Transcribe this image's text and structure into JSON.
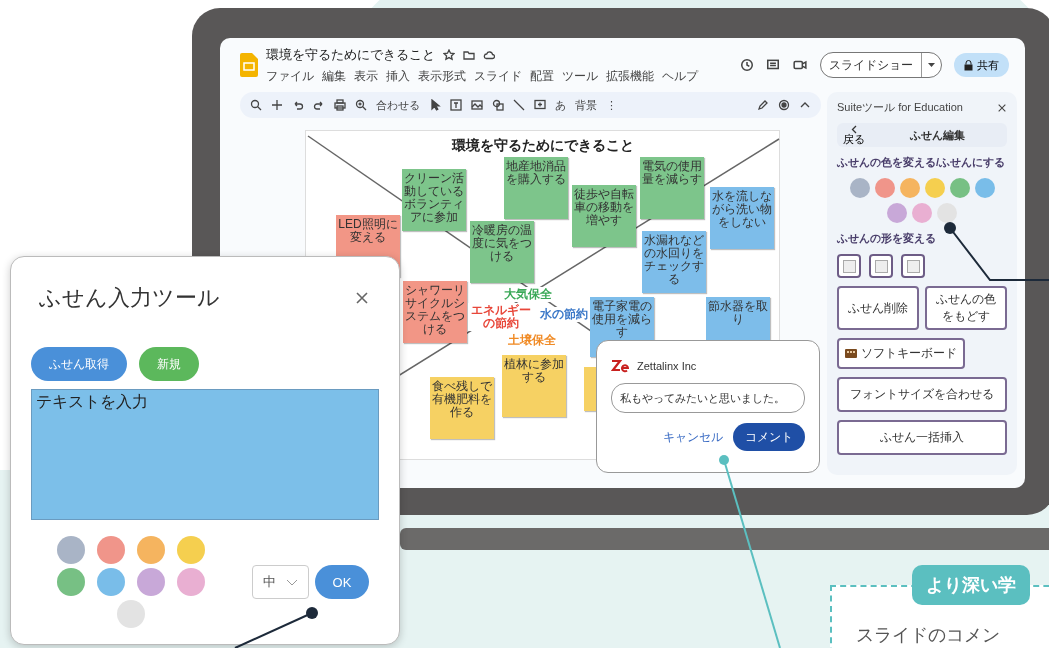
{
  "editor": {
    "title": "環境を守るためにできること",
    "menu": [
      "ファイル",
      "編集",
      "表示",
      "挿入",
      "表示形式",
      "スライド",
      "配置",
      "ツール",
      "拡張機能",
      "ヘルプ"
    ],
    "slideshow_button": "スライドショー",
    "share_button": "共有",
    "toolbar": {
      "zoom": "合わせる",
      "input_mode": "あ",
      "background": "背景",
      "more": "⋮"
    },
    "slide": {
      "title": "環境を守るためにできること",
      "notes": [
        {
          "text": "LED照明に変える",
          "color": "#f29686"
        },
        {
          "text": "クリーン活動しているボランティアに参加",
          "color": "#7dc58b"
        },
        {
          "text": "冷暖房の温度に気をつける",
          "color": "#7dc58b"
        },
        {
          "text": "地産地消品を購入する",
          "color": "#7dc58b"
        },
        {
          "text": "徒歩や自転車の移動を増やす",
          "color": "#7dc58b"
        },
        {
          "text": "電気の使用量を減らす",
          "color": "#7dc58b"
        },
        {
          "text": "水を流しながら洗い物をしない",
          "color": "#7dbdea"
        },
        {
          "text": "水漏れなどの水回りをチェックする",
          "color": "#7dbdea"
        },
        {
          "text": "シャワーリサイクルシステムをつける",
          "color": "#f29686"
        },
        {
          "text": "電子家電の使用を減らす",
          "color": "#7dbdea"
        },
        {
          "text": "節水器を取り",
          "color": "#7dbdea"
        },
        {
          "text": "植林に参加する",
          "color": "#f6d163"
        },
        {
          "text": "食べ残しで有機肥料を作る",
          "color": "#f6d163"
        },
        {
          "color": "#f6d163"
        }
      ],
      "labels": [
        {
          "text": "大気保全",
          "color": "#3aa857"
        },
        {
          "text": "エネルギーの節約",
          "color": "#e8473a"
        },
        {
          "text": "水の節約",
          "color": "#3b78c8"
        },
        {
          "text": "土壌保全",
          "color": "#f08a24"
        }
      ]
    }
  },
  "side_panel": {
    "title": "Suiteツール for Education",
    "back_label": "戻る",
    "heading": "ふせん編集",
    "color_section": "ふせんの色を変える/ふせんにする",
    "colors": [
      {
        "color": "#a9b4c6"
      },
      {
        "color": "#f0958a"
      },
      {
        "color": "#f5b45f"
      },
      {
        "color": "#f5cf4f"
      },
      {
        "color": "#77c084"
      },
      {
        "color": "#79bde9"
      },
      {
        "color": "#c8a8d8"
      },
      {
        "color": "#e9afd2"
      },
      {
        "color": "#e3e3e3"
      }
    ],
    "shape_section": "ふせんの形を変える",
    "buttons": [
      {
        "kind": "small",
        "label": "ふせん削除"
      },
      {
        "kind": "small",
        "label": "ふせんの色をもどす"
      },
      {
        "kind": "icon",
        "label": "ソフトキーボード"
      },
      {
        "kind": "wide",
        "label": "フォントサイズを合わせる"
      },
      {
        "kind": "wide",
        "label": "ふせん一括挿入"
      }
    ]
  },
  "input_dialog": {
    "title": "ふせん入力ツール",
    "get_button": "ふせん取得",
    "new_button": "新規",
    "text_value": "テキストを入力",
    "colors": [
      {
        "color": "#a9b4c6"
      },
      {
        "color": "#f0958a"
      },
      {
        "color": "#f5b45f"
      },
      {
        "color": "#f5cf4f"
      },
      {
        "color": "#77c084"
      },
      {
        "color": "#79bde9"
      },
      {
        "color": "#c8a8d8"
      },
      {
        "color": "#e9afd2"
      },
      {
        "color": "#e3e3e3"
      }
    ],
    "size_select": "中",
    "ok_button": "OK"
  },
  "comment_popup": {
    "author": "Zettalinx Inc",
    "comment_value": "私もやってみたいと思いました。",
    "cancel_button": "キャンセル",
    "comment_button": "コメント"
  },
  "callout": {
    "tag": "より深い学",
    "text": "スライドのコメン"
  }
}
